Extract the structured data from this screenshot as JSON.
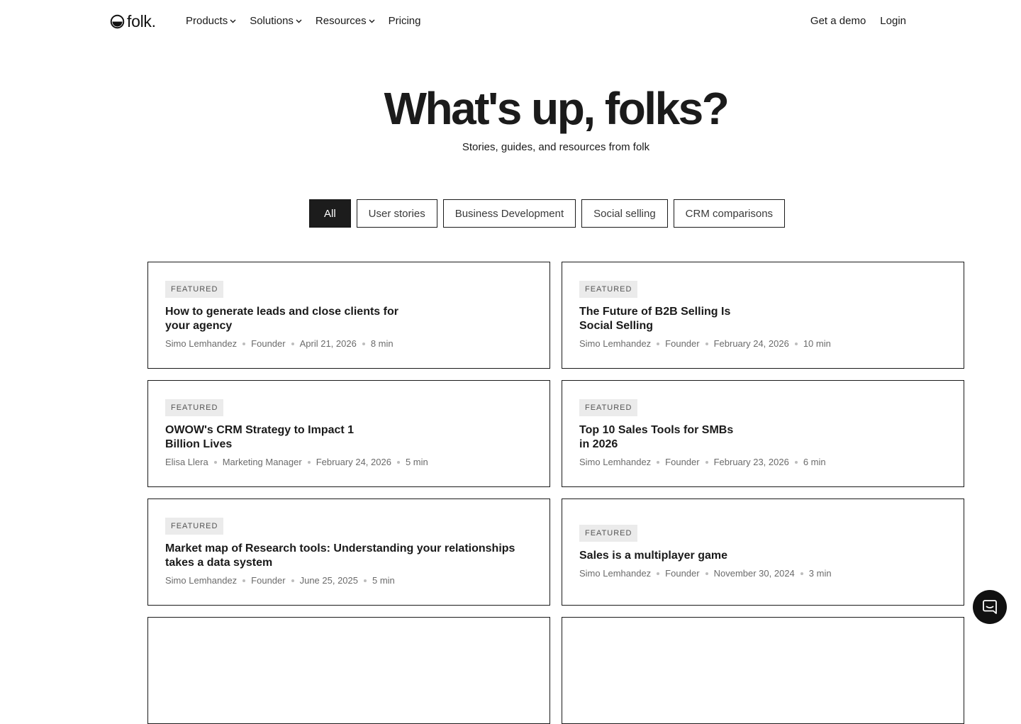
{
  "brand": {
    "logo_text": "folk."
  },
  "nav": {
    "menu": [
      {
        "label": "Products",
        "has_dropdown": true
      },
      {
        "label": "Solutions",
        "has_dropdown": true
      },
      {
        "label": "Resources",
        "has_dropdown": true
      },
      {
        "label": "Pricing",
        "has_dropdown": false
      }
    ],
    "get_demo": "Get a demo",
    "login": "Login"
  },
  "hero": {
    "title": "What's up, folks?",
    "subtitle": "Stories, guides, and resources from folk"
  },
  "filters": [
    {
      "label": "All",
      "active": true
    },
    {
      "label": "User stories",
      "active": false
    },
    {
      "label": "Business Development",
      "active": false
    },
    {
      "label": "Social selling",
      "active": false
    },
    {
      "label": "CRM comparisons",
      "active": false
    }
  ],
  "cards": [
    {
      "badge": "FEATURED",
      "title_line1": "How to generate leads and close clients for",
      "title_line2": "your agency",
      "author": "Simo Lemhandez",
      "role": "Founder",
      "date": "April 21, 2026",
      "read_time": "8 min"
    },
    {
      "badge": "FEATURED",
      "title_line1": "The Future of B2B Selling Is",
      "title_line2": "Social Selling",
      "author": "Simo Lemhandez",
      "role": "Founder",
      "date": "February 24, 2026",
      "read_time": "10 min"
    },
    {
      "badge": "FEATURED",
      "title_line1": "OWOW's CRM Strategy to Impact 1",
      "title_line2": "Billion Lives",
      "author": "Elisa Llera",
      "role": "Marketing Manager",
      "date": "February 24, 2026",
      "read_time": "5 min"
    },
    {
      "badge": "FEATURED",
      "title_line1": "Top 10 Sales Tools for SMBs",
      "title_line2": "in 2026",
      "author": "Simo Lemhandez",
      "role": "Founder",
      "date": "February 23, 2026",
      "read_time": "6 min"
    },
    {
      "badge": "FEATURED",
      "title_line1": "Market map of Research tools: Understanding your relationships",
      "title_line2": "takes a data system",
      "author": "Simo Lemhandez",
      "role": "Founder",
      "date": "June 25, 2025",
      "read_time": "5 min"
    },
    {
      "badge": "FEATURED",
      "title_line1": "Sales is a multiplayer game",
      "title_line2": "",
      "author": "Simo Lemhandez",
      "role": "Founder",
      "date": "November 30, 2024",
      "read_time": "3 min"
    }
  ],
  "icons": {
    "logo": "folk-logo-icon",
    "dropdown": "chevron-down-icon",
    "chat": "chat-icon"
  }
}
